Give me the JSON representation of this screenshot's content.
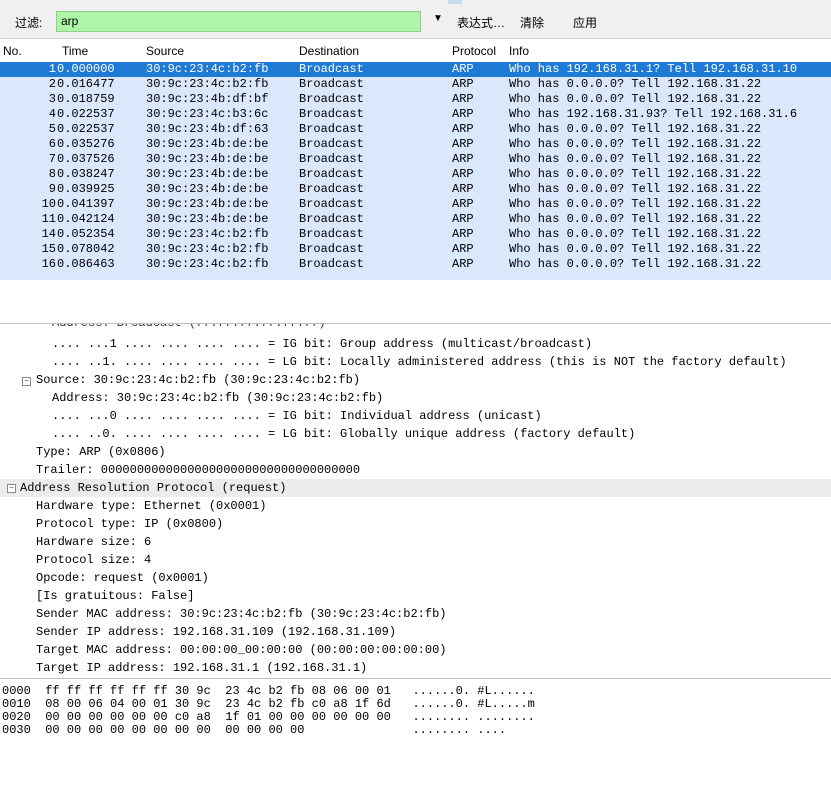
{
  "filter": {
    "label": "过滤:",
    "value": "arp",
    "expression_label": "表达式…",
    "clear_label": "清除",
    "apply_label": "应用"
  },
  "packet_list": {
    "columns": [
      "No.",
      "Time",
      "Source",
      "Destination",
      "Protocol",
      "Info"
    ],
    "rows": [
      {
        "no": "1",
        "time": "0.000000",
        "src": "30:9c:23:4c:b2:fb",
        "dst": "Broadcast",
        "proto": "ARP",
        "info": "Who has 192.168.31.1?  Tell 192.168.31.10"
      },
      {
        "no": "2",
        "time": "0.016477",
        "src": "30:9c:23:4c:b2:fb",
        "dst": "Broadcast",
        "proto": "ARP",
        "info": "Who has 0.0.0.0?  Tell 192.168.31.22"
      },
      {
        "no": "3",
        "time": "0.018759",
        "src": "30:9c:23:4b:df:bf",
        "dst": "Broadcast",
        "proto": "ARP",
        "info": "Who has 0.0.0.0?  Tell 192.168.31.22"
      },
      {
        "no": "4",
        "time": "0.022537",
        "src": "30:9c:23:4c:b3:6c",
        "dst": "Broadcast",
        "proto": "ARP",
        "info": "Who has 192.168.31.93?  Tell 192.168.31.6"
      },
      {
        "no": "5",
        "time": "0.022537",
        "src": "30:9c:23:4b:df:63",
        "dst": "Broadcast",
        "proto": "ARP",
        "info": "Who has 0.0.0.0?  Tell 192.168.31.22"
      },
      {
        "no": "6",
        "time": "0.035276",
        "src": "30:9c:23:4b:de:be",
        "dst": "Broadcast",
        "proto": "ARP",
        "info": "Who has 0.0.0.0?  Tell 192.168.31.22"
      },
      {
        "no": "7",
        "time": "0.037526",
        "src": "30:9c:23:4b:de:be",
        "dst": "Broadcast",
        "proto": "ARP",
        "info": "Who has 0.0.0.0?  Tell 192.168.31.22"
      },
      {
        "no": "8",
        "time": "0.038247",
        "src": "30:9c:23:4b:de:be",
        "dst": "Broadcast",
        "proto": "ARP",
        "info": "Who has 0.0.0.0?  Tell 192.168.31.22"
      },
      {
        "no": "9",
        "time": "0.039925",
        "src": "30:9c:23:4b:de:be",
        "dst": "Broadcast",
        "proto": "ARP",
        "info": "Who has 0.0.0.0?  Tell 192.168.31.22"
      },
      {
        "no": "10",
        "time": "0.041397",
        "src": "30:9c:23:4b:de:be",
        "dst": "Broadcast",
        "proto": "ARP",
        "info": "Who has 0.0.0.0?  Tell 192.168.31.22"
      },
      {
        "no": "11",
        "time": "0.042124",
        "src": "30:9c:23:4b:de:be",
        "dst": "Broadcast",
        "proto": "ARP",
        "info": "Who has 0.0.0.0?  Tell 192.168.31.22"
      },
      {
        "no": "14",
        "time": "0.052354",
        "src": "30:9c:23:4c:b2:fb",
        "dst": "Broadcast",
        "proto": "ARP",
        "info": "Who has 0.0.0.0?  Tell 192.168.31.22"
      },
      {
        "no": "15",
        "time": "0.078042",
        "src": "30:9c:23:4c:b2:fb",
        "dst": "Broadcast",
        "proto": "ARP",
        "info": "Who has 0.0.0.0?  Tell 192.168.31.22"
      },
      {
        "no": "16",
        "time": "0.086463",
        "src": "30:9c:23:4c:b2:fb",
        "dst": "Broadcast",
        "proto": "ARP",
        "info": "Who has 0.0.0.0?  Tell 192.168.31.22"
      }
    ]
  },
  "details": {
    "lines": [
      "Address: Broadcast (ff:ff:ff:ff:ff:ff)",
      ".... ...1 .... .... .... .... = IG bit: Group address (multicast/broadcast)",
      ".... ..1. .... .... .... .... = LG bit: Locally administered address (this is NOT the factory default)",
      "Source: 30:9c:23:4c:b2:fb (30:9c:23:4c:b2:fb)",
      "Address: 30:9c:23:4c:b2:fb (30:9c:23:4c:b2:fb)",
      ".... ...0 .... .... .... .... = IG bit: Individual address (unicast)",
      ".... ..0. .... .... .... .... = LG bit: Globally unique address (factory default)",
      "Type: ARP (0x0806)",
      "Trailer: 000000000000000000000000000000000000",
      "Address Resolution Protocol (request)",
      "Hardware type: Ethernet (0x0001)",
      "Protocol type: IP (0x0800)",
      "Hardware size: 6",
      "Protocol size: 4",
      "Opcode: request (0x0001)",
      "[Is gratuitous: False]",
      "Sender MAC address: 30:9c:23:4c:b2:fb (30:9c:23:4c:b2:fb)",
      "Sender IP address: 192.168.31.109 (192.168.31.109)",
      "Target MAC address: 00:00:00_00:00:00 (00:00:00:00:00:00)",
      "Target IP address: 192.168.31.1 (192.168.31.1)"
    ]
  },
  "hex": {
    "lines": [
      "0000  ff ff ff ff ff ff 30 9c  23 4c b2 fb 08 06 00 01   ......0. #L......",
      "0010  08 00 06 04 00 01 30 9c  23 4c b2 fb c0 a8 1f 6d   ......0. #L.....m",
      "0020  00 00 00 00 00 00 c0 a8  1f 01 00 00 00 00 00 00   ........ ........",
      "0030  00 00 00 00 00 00 00 00  00 00 00 00               ........ ...."
    ]
  },
  "colors": {
    "filter_bg": "#aff5a8",
    "row_bg": "#dbe8fb",
    "selected_row_bg": "#1f7ad6"
  }
}
